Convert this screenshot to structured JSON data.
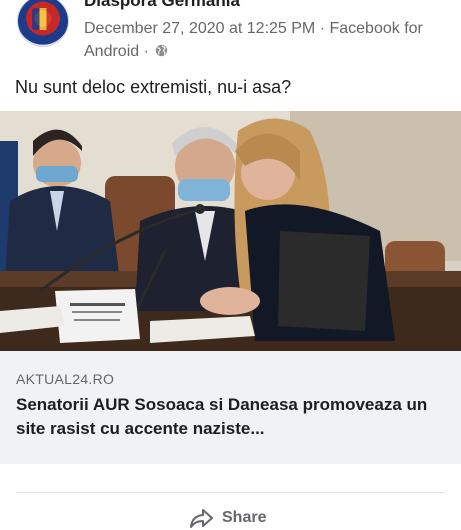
{
  "post": {
    "page_name": "Diaspora Germania",
    "timestamp": "December 27, 2020 at 12:25 PM",
    "separator": "·",
    "source": "Facebook for Android",
    "privacy_icon": "globe-icon",
    "caption": "Nu sunt deloc extremisti, nu-i asa?"
  },
  "link_preview": {
    "domain": "AKTUAL24.RO",
    "title": "Senatorii AUR Sosoaca si Daneasa promoveaza un site rasist cu accente naziste..."
  },
  "actions": {
    "share_label": "Share",
    "share_icon": "share-icon"
  }
}
